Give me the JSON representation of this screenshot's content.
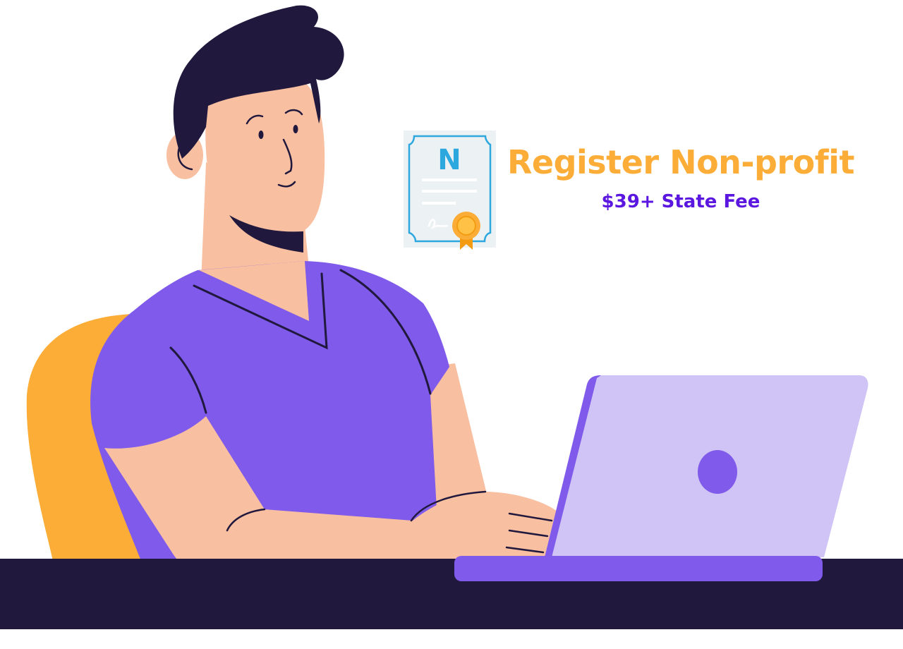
{
  "headline": {
    "title": "Register Non-profit",
    "fee": "$39+ State Fee"
  },
  "certificate": {
    "letter": "N"
  },
  "colors": {
    "title": "#fbad38",
    "fee": "#5b17e0",
    "shirt": "#7f5aeb",
    "hair": "#21183d",
    "skin": "#f8bfa1",
    "chair": "#fbad38",
    "laptop": "#d0c3f5",
    "desk": "#21183d"
  },
  "icons": [
    "certificate-icon",
    "award-ribbon-icon",
    "laptop-logo-icon"
  ]
}
